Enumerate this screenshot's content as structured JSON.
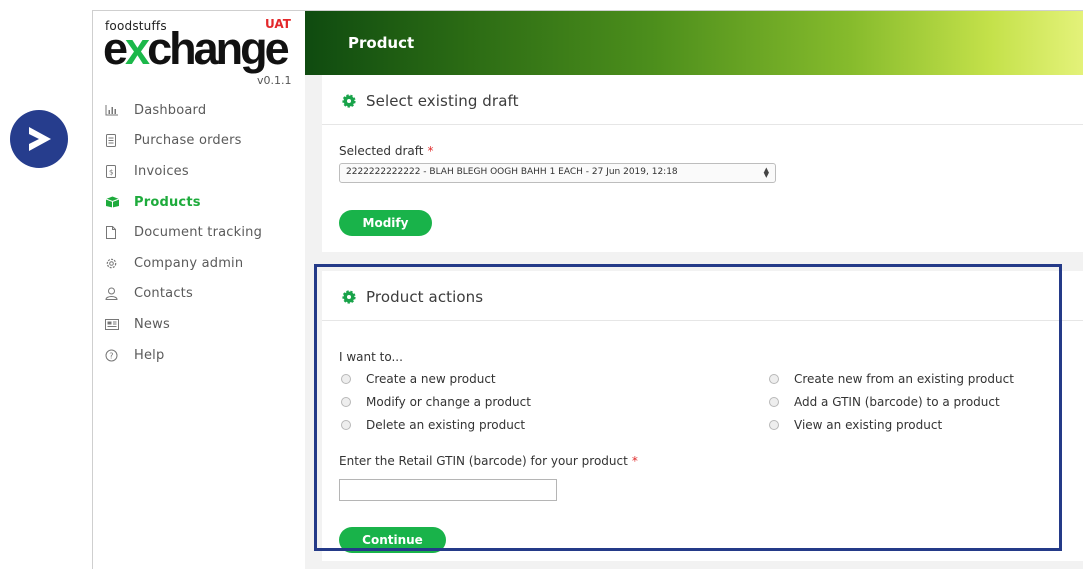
{
  "colors": {
    "brand_green": "#19b34a",
    "highlight_border": "#243a88",
    "required": "#e02d2d"
  },
  "overlay": {
    "next_icon": "arrow-right-icon"
  },
  "logo": {
    "small_text": "foodstuffs",
    "badge": "UAT",
    "word_pre": "e",
    "word_x": "x",
    "word_post": "change",
    "version": "v0.1.1"
  },
  "sidebar": {
    "items": [
      {
        "label": "Dashboard",
        "icon": "bar-chart-icon",
        "active": false
      },
      {
        "label": "Purchase orders",
        "icon": "document-list-icon",
        "active": false
      },
      {
        "label": "Invoices",
        "icon": "invoice-icon",
        "active": false
      },
      {
        "label": "Products",
        "icon": "box-icon",
        "active": true
      },
      {
        "label": "Document tracking",
        "icon": "file-icon",
        "active": false
      },
      {
        "label": "Company admin",
        "icon": "gear-icon",
        "active": false
      },
      {
        "label": "Contacts",
        "icon": "person-icon",
        "active": false
      },
      {
        "label": "News",
        "icon": "newspaper-icon",
        "active": false
      },
      {
        "label": "Help",
        "icon": "help-circle-icon",
        "active": false
      }
    ]
  },
  "header": {
    "title": "Product"
  },
  "draft_card": {
    "title": "Select existing draft",
    "field_label": "Selected draft",
    "required_mark": "*",
    "selected_value": "2222222222222 - BLAH BLEGH OOGH BAHH 1 EACH - 27 Jun 2019, 12:18",
    "modify_button": "Modify"
  },
  "actions_card": {
    "title": "Product actions",
    "prompt": "I want to...",
    "options_left": [
      "Create a new product",
      "Modify or change a product",
      "Delete an existing product"
    ],
    "options_right": [
      "Create new from an existing product",
      "Add a GTIN (barcode) to a product",
      "View an existing product"
    ],
    "gtin_label": "Enter the Retail GTIN (barcode) for your product",
    "required_mark": "*",
    "gtin_value": "",
    "continue_button": "Continue"
  }
}
